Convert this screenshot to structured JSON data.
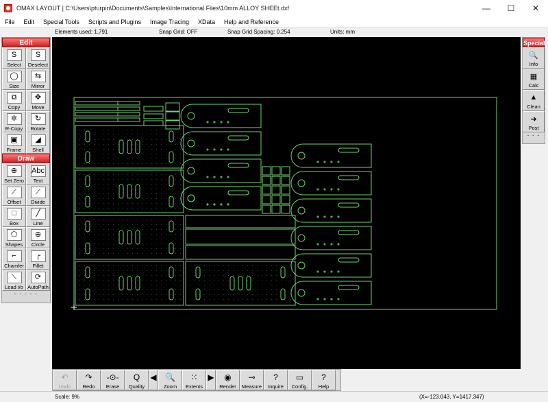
{
  "window": {
    "title": "OMAX LAYOUT | C:\\Users\\pturpin\\Documents\\Samples\\International Files\\10mm ALLOY SHEEt.dxf",
    "minimize": "—",
    "maximize": "☐",
    "close": "✕"
  },
  "menu": [
    "File",
    "Edit",
    "Special Tools",
    "Scripts and Plugins",
    "Image Tracing",
    "XData",
    "Help and Reference"
  ],
  "status_top": {
    "elements": "Elements used: 1,791",
    "snap_grid": "Snap Grid: OFF",
    "snap_spacing": "Snap Grid Spacing: 0.254",
    "units": "Units: mm"
  },
  "left_panel": {
    "edit_header": "Edit",
    "edit_tools": [
      {
        "label": "Select",
        "icon": "S"
      },
      {
        "label": "Deselect",
        "icon": "S"
      },
      {
        "label": "Size",
        "icon": "◯"
      },
      {
        "label": "Mirror",
        "icon": "⇆"
      },
      {
        "label": "Copy",
        "icon": "⧉"
      },
      {
        "label": "Move",
        "icon": "✥"
      },
      {
        "label": "R-Copy",
        "icon": "✲"
      },
      {
        "label": "Rotate",
        "icon": "↻"
      },
      {
        "label": "Frame",
        "icon": "▣"
      },
      {
        "label": "Shell",
        "icon": "◢"
      }
    ],
    "draw_header": "Draw",
    "draw_tools": [
      {
        "label": "Set Zero",
        "icon": "⊕"
      },
      {
        "label": "Text",
        "icon": "Abc"
      },
      {
        "label": "Offset",
        "icon": "⟋"
      },
      {
        "label": "Divide",
        "icon": "⟋"
      },
      {
        "label": "Box",
        "icon": "□"
      },
      {
        "label": "Line",
        "icon": "╱"
      },
      {
        "label": "Shapes",
        "icon": "⬠"
      },
      {
        "label": "Circle",
        "icon": "⊕"
      },
      {
        "label": "Chamfer",
        "icon": "⌐"
      },
      {
        "label": "Fillet",
        "icon": "╭"
      },
      {
        "label": "Lead i/o",
        "icon": "⟍"
      },
      {
        "label": "AutoPath",
        "icon": "⟳"
      }
    ],
    "more": "- - - - -"
  },
  "right_panel": {
    "header": "Special",
    "tools": [
      {
        "label": "Info",
        "icon": "🔍"
      },
      {
        "label": "Calc",
        "icon": "▦"
      },
      {
        "label": "Clean",
        "icon": "▲"
      },
      {
        "label": "Post",
        "icon": "➜"
      }
    ],
    "more": "- - -"
  },
  "bottom_tools": [
    {
      "label": "Undo",
      "icon": "↶",
      "enabled": false
    },
    {
      "label": "Redo",
      "icon": "↷",
      "enabled": true
    },
    {
      "label": "Erase",
      "icon": "-⊙-",
      "enabled": true
    },
    {
      "label": "Quality",
      "icon": "Q",
      "enabled": true
    },
    {
      "label": "",
      "icon": "◀",
      "enabled": true,
      "narrow": true
    },
    {
      "label": "Zoom",
      "icon": "🔍",
      "enabled": true
    },
    {
      "label": "Extents",
      "icon": "⁙",
      "enabled": true
    },
    {
      "label": "",
      "icon": "▶",
      "enabled": true,
      "narrow": true
    },
    {
      "label": "Render",
      "icon": "◉",
      "enabled": true
    },
    {
      "label": "Measure",
      "icon": "⊸",
      "enabled": true
    },
    {
      "label": "Inquire",
      "icon": "?",
      "enabled": true
    },
    {
      "label": "Config.",
      "icon": "▭",
      "enabled": true
    },
    {
      "label": "Help",
      "icon": "?",
      "enabled": true
    }
  ],
  "status_bottom": {
    "scale": "Scale: 9%",
    "coords": "(X=-123.043, Y=1417.347)"
  },
  "colors": {
    "canvas": "#000000",
    "geometry": "#6fd36f",
    "accent": "#d22b2b"
  }
}
